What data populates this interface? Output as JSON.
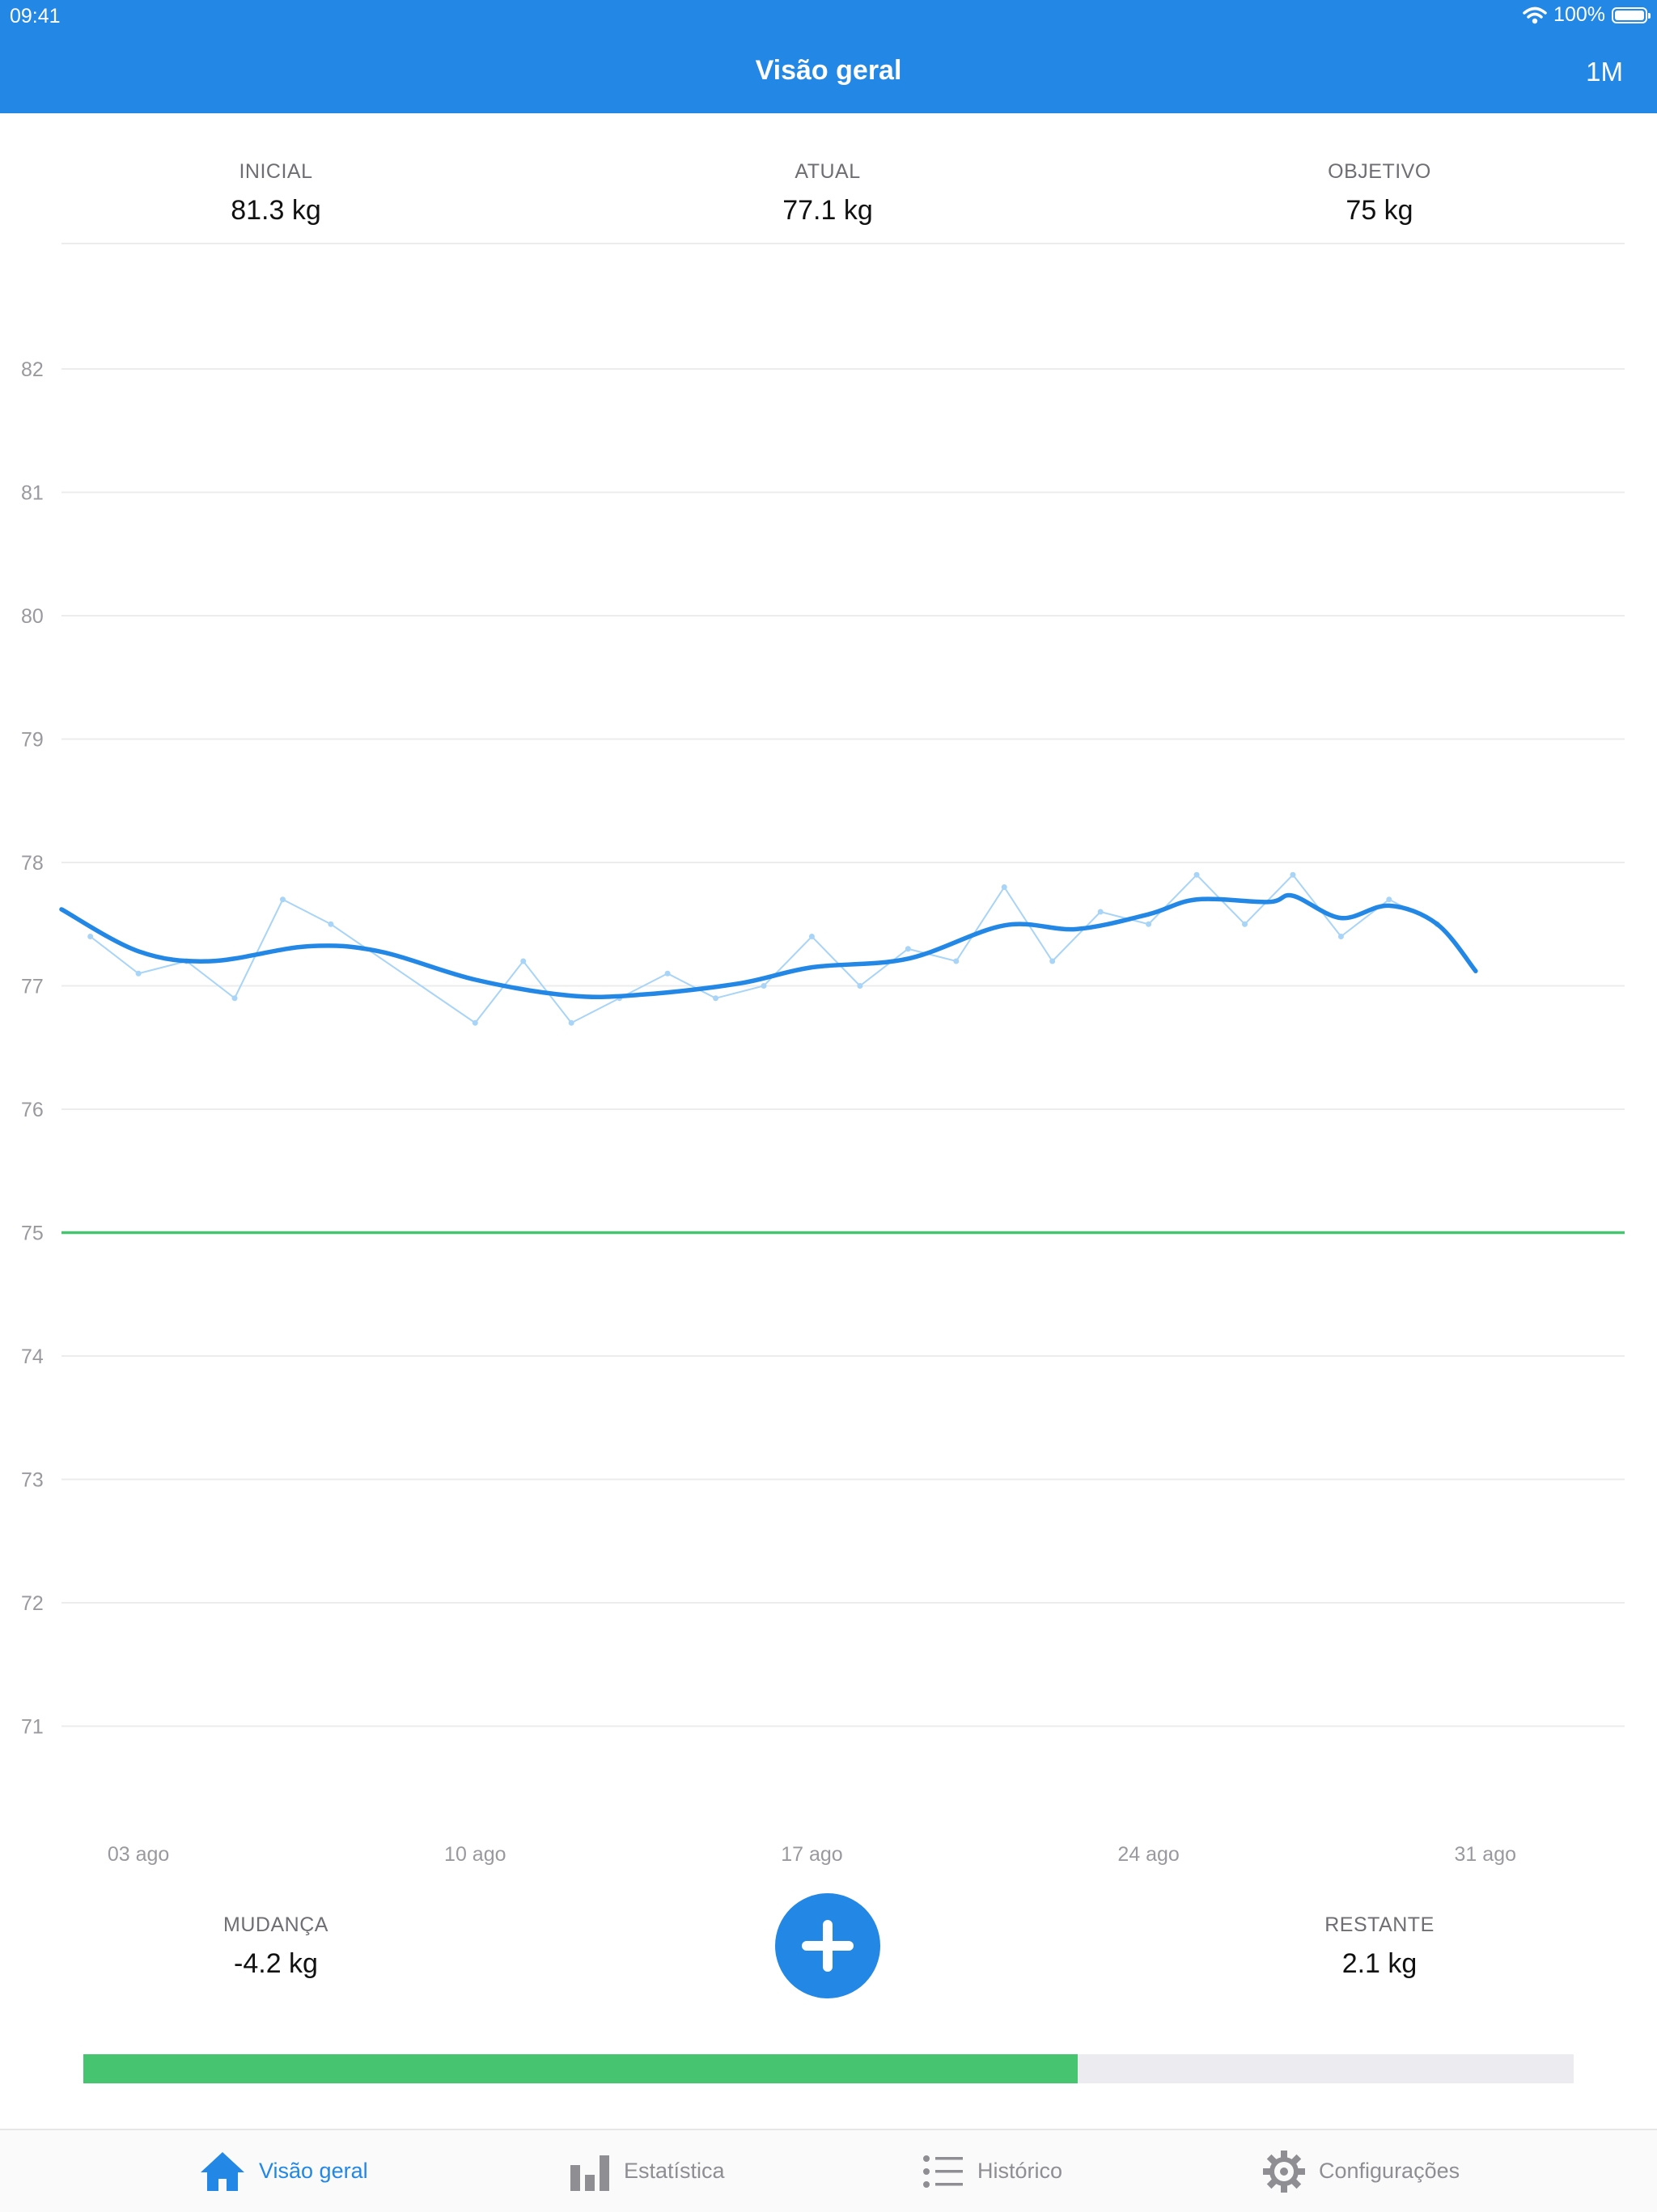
{
  "status_bar": {
    "time": "09:41",
    "battery": "100%"
  },
  "header": {
    "title": "Visão geral",
    "range": "1M"
  },
  "summary": {
    "initial": {
      "label": "INICIAL",
      "value": "81.3 kg"
    },
    "current": {
      "label": "ATUAL",
      "value": "77.1 kg"
    },
    "goal": {
      "label": "OBJETIVO",
      "value": "75 kg"
    }
  },
  "chart_data": {
    "type": "line",
    "x_tick_labels": [
      "03 ago",
      "10 ago",
      "17 ago",
      "24 ago",
      "31 ago"
    ],
    "y_tick_labels": [
      "82",
      "81",
      "80",
      "79",
      "78",
      "77",
      "76",
      "75",
      "74",
      "73",
      "72",
      "71"
    ],
    "ylim": [
      70.5,
      82.5
    ],
    "x_range_day": [
      1.4,
      32.4
    ],
    "grid": true,
    "goal_line": 75,
    "colors": {
      "trend": "#2387E6",
      "raw": "#A8D4F7",
      "goal": "#47C46F"
    },
    "series": [
      {
        "kind": "raw",
        "points": [
          {
            "day": 2,
            "y": 77.4
          },
          {
            "day": 3,
            "y": 77.1
          },
          {
            "day": 4,
            "y": 77.2
          },
          {
            "day": 5,
            "y": 76.9
          },
          {
            "day": 6,
            "y": 77.7
          },
          {
            "day": 7,
            "y": 77.5
          },
          {
            "day": 10,
            "y": 76.7
          },
          {
            "day": 11,
            "y": 77.2
          },
          {
            "day": 12,
            "y": 76.7
          },
          {
            "day": 13,
            "y": 76.9
          },
          {
            "day": 14,
            "y": 77.1
          },
          {
            "day": 15,
            "y": 76.9
          },
          {
            "day": 16,
            "y": 77.0
          },
          {
            "day": 17,
            "y": 77.4
          },
          {
            "day": 18,
            "y": 77.0
          },
          {
            "day": 19,
            "y": 77.3
          },
          {
            "day": 20,
            "y": 77.2
          },
          {
            "day": 21,
            "y": 77.8
          },
          {
            "day": 22,
            "y": 77.2
          },
          {
            "day": 23,
            "y": 77.6
          },
          {
            "day": 24,
            "y": 77.5
          },
          {
            "day": 25,
            "y": 77.9
          },
          {
            "day": 26,
            "y": 77.5
          },
          {
            "day": 27,
            "y": 77.9
          },
          {
            "day": 28,
            "y": 77.4
          },
          {
            "day": 29,
            "y": 77.7
          },
          {
            "day": 30,
            "y": 77.5
          }
        ]
      },
      {
        "kind": "trend",
        "points": [
          {
            "day": 1.4,
            "y": 77.62
          },
          {
            "day": 3,
            "y": 77.28
          },
          {
            "day": 4.5,
            "y": 77.2
          },
          {
            "day": 6.5,
            "y": 77.32
          },
          {
            "day": 8,
            "y": 77.28
          },
          {
            "day": 10,
            "y": 77.05
          },
          {
            "day": 12,
            "y": 76.92
          },
          {
            "day": 13.5,
            "y": 76.93
          },
          {
            "day": 15.5,
            "y": 77.02
          },
          {
            "day": 17,
            "y": 77.15
          },
          {
            "day": 19,
            "y": 77.22
          },
          {
            "day": 21,
            "y": 77.49
          },
          {
            "day": 22.5,
            "y": 77.46
          },
          {
            "day": 24,
            "y": 77.58
          },
          {
            "day": 25,
            "y": 77.7
          },
          {
            "day": 26.5,
            "y": 77.68
          },
          {
            "day": 27,
            "y": 77.73
          },
          {
            "day": 28,
            "y": 77.55
          },
          {
            "day": 29,
            "y": 77.65
          },
          {
            "day": 30,
            "y": 77.5
          },
          {
            "day": 30.8,
            "y": 77.12
          }
        ]
      }
    ]
  },
  "footer_stats": {
    "change": {
      "label": "MUDANÇA",
      "value": "-4.2 kg"
    },
    "remaining": {
      "label": "RESTANTE",
      "value": "2.1 kg"
    }
  },
  "progress": {
    "fraction": 0.667
  },
  "tabs": [
    {
      "label": "Visão geral",
      "icon": "home-icon",
      "active": true
    },
    {
      "label": "Estatística",
      "icon": "bar-chart-icon",
      "active": false
    },
    {
      "label": "Histórico",
      "icon": "list-icon",
      "active": false
    },
    {
      "label": "Configurações",
      "icon": "gear-icon",
      "active": false
    }
  ]
}
